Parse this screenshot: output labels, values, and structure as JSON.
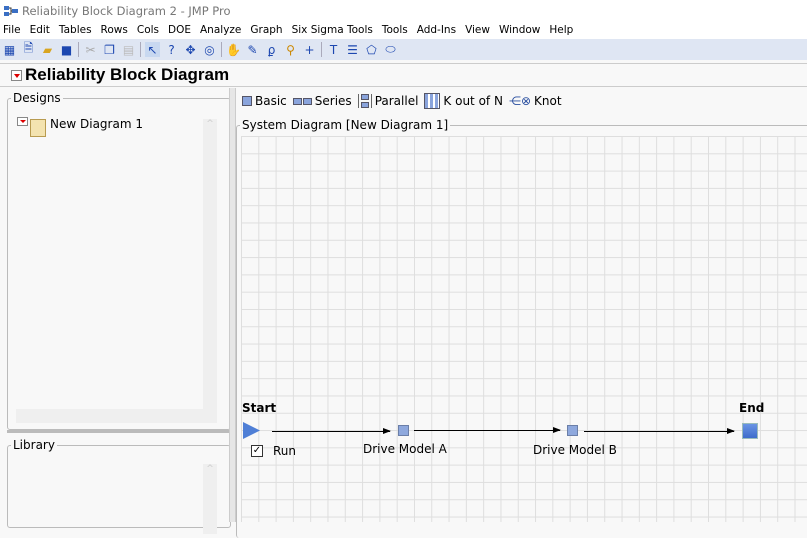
{
  "window": {
    "title": "Reliability Block Diagram 2 - JMP Pro"
  },
  "menu": [
    "File",
    "Edit",
    "Tables",
    "Rows",
    "Cols",
    "DOE",
    "Analyze",
    "Graph",
    "Six Sigma Tools",
    "Tools",
    "Add-Ins",
    "View",
    "Window",
    "Help"
  ],
  "report": {
    "title": "Reliability Block Diagram"
  },
  "designs": {
    "label": "Designs",
    "items": [
      {
        "label": "New Diagram 1"
      }
    ]
  },
  "library": {
    "label": "Library"
  },
  "palette": {
    "basic": "Basic",
    "series": "Series",
    "parallel": "Parallel",
    "k_out_of_n": "K out of N",
    "knot": "Knot"
  },
  "diagram": {
    "title": "System Diagram [New Diagram 1]",
    "start": "Start",
    "end": "End",
    "run_label": "Run",
    "run_checked": true,
    "blocks": [
      {
        "label": "Drive Model A"
      },
      {
        "label": "Drive Model B"
      }
    ]
  }
}
